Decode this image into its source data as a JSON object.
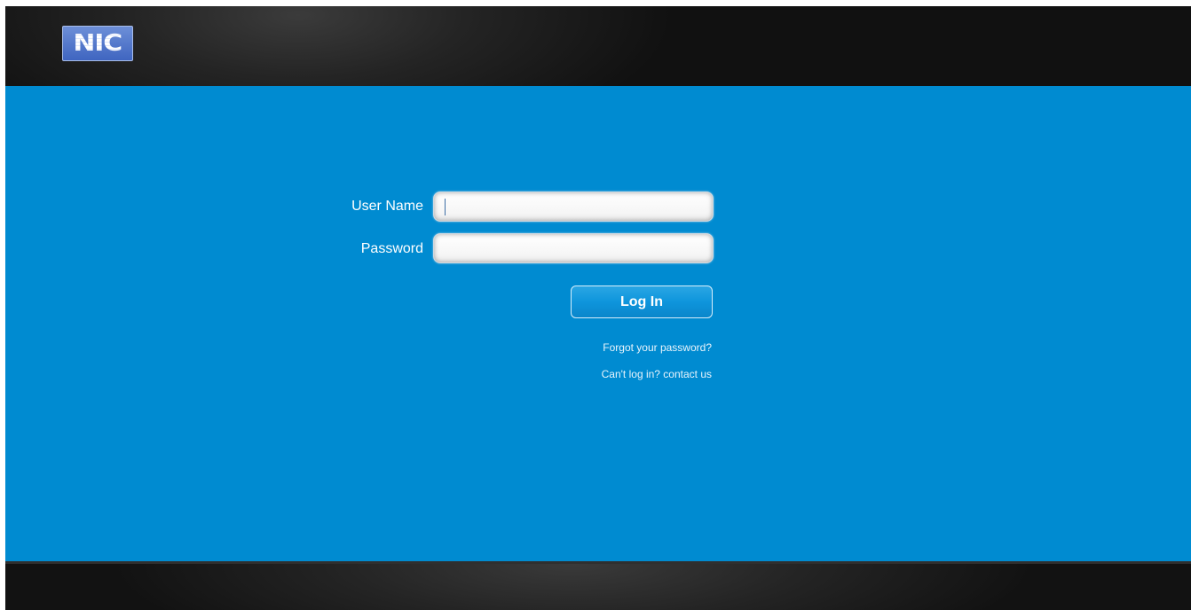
{
  "header": {
    "logo_text": "NIC"
  },
  "login_form": {
    "username_label": "User Name",
    "username_value": "",
    "password_label": "Password",
    "password_value": "",
    "login_button_label": "Log In",
    "forgot_password_link": "Forgot your password?",
    "contact_link": "Can't log in? contact us"
  },
  "colors": {
    "main_background": "#008bd1",
    "header_background": "#1a1a1a",
    "footer_background": "#1a1a1a",
    "text": "#ffffff"
  }
}
